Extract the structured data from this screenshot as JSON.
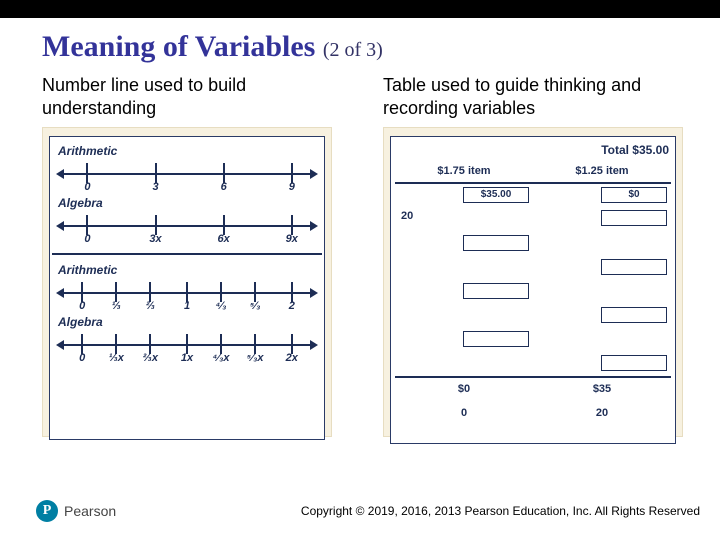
{
  "title": {
    "main": "Meaning of Variables",
    "counter": "(2 of 3)"
  },
  "left": {
    "header": "Number line used to build understanding",
    "labels": {
      "arith": "Arithmetic",
      "algebra": "Algebra"
    },
    "group1": {
      "arith": [
        "0",
        "3",
        "6",
        "9"
      ],
      "algebra": [
        "0",
        "3x",
        "6x",
        "9x"
      ]
    },
    "group2": {
      "arith": [
        "0",
        "⅓",
        "⅔",
        "1",
        "⁴⁄₃",
        "⁵⁄₃",
        "2"
      ],
      "algebra": [
        "0",
        "⅓x",
        "⅔x",
        "1x",
        "⁴⁄₃x",
        "⁵⁄₃x",
        "2x"
      ]
    }
  },
  "right": {
    "header": "Table used to guide thinking and recording variables",
    "total_label": "Total $35.00",
    "col1": "$1.75 item",
    "col2": "$1.25 item",
    "first_row_box1": "$35.00",
    "first_row_box2": "$0",
    "second_row_left": "20",
    "footer_row1_c1": "$0",
    "footer_row1_c2": "$35",
    "footer_row2_c1": "0",
    "footer_row2_c2": "20"
  },
  "footer": {
    "brand": "Pearson",
    "brand_glyph": "P",
    "copyright": "Copyright © 2019, 2016, 2013 Pearson Education, Inc. All Rights Reserved"
  }
}
